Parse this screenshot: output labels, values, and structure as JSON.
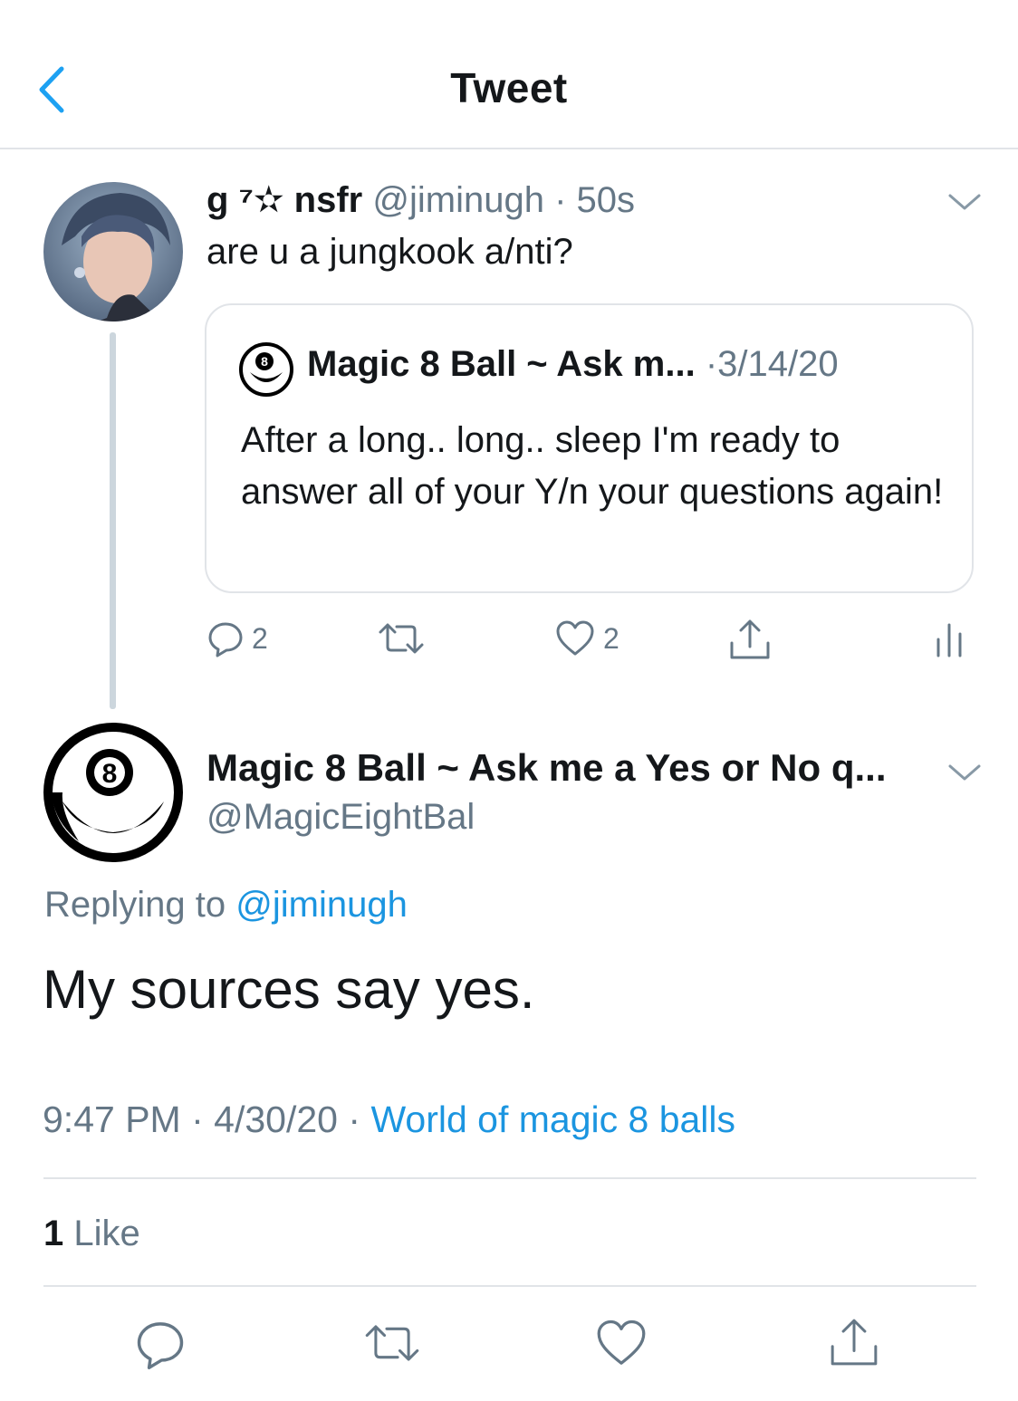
{
  "header": {
    "title": "Tweet",
    "back_icon": "chevron-left-icon",
    "accent_color": "#1da1f2"
  },
  "parent_tweet": {
    "display_name": "g ⁷✫ nsfr",
    "handle": "@jiminugh",
    "separator": "·",
    "time": "50s",
    "text": "are u a jungkook a/nti?",
    "quoted": {
      "display_name": "Magic 8 Ball ~ Ask m...",
      "separator": "·",
      "date": "3/14/20",
      "text": "After a long.. long.. sleep I'm ready to answer all of your Y/n your questions again!"
    },
    "actions": {
      "reply_count": "2",
      "like_count": "2"
    }
  },
  "main_tweet": {
    "display_name": "Magic 8 Ball ~ Ask me a Yes or No q...",
    "handle": "@MagicEightBal",
    "replying_prefix": "Replying to",
    "replying_handle": "@jiminugh",
    "text": "My sources say yes.",
    "time": "9:47 PM",
    "separator1": "·",
    "date": "4/30/20",
    "separator2": "·",
    "source": "World of magic 8 balls",
    "likes_count": "1",
    "likes_label": "Like"
  },
  "colors": {
    "text": "#14171a",
    "secondary": "#657786",
    "link": "#1b95e0",
    "divider": "#e1e4e8"
  }
}
